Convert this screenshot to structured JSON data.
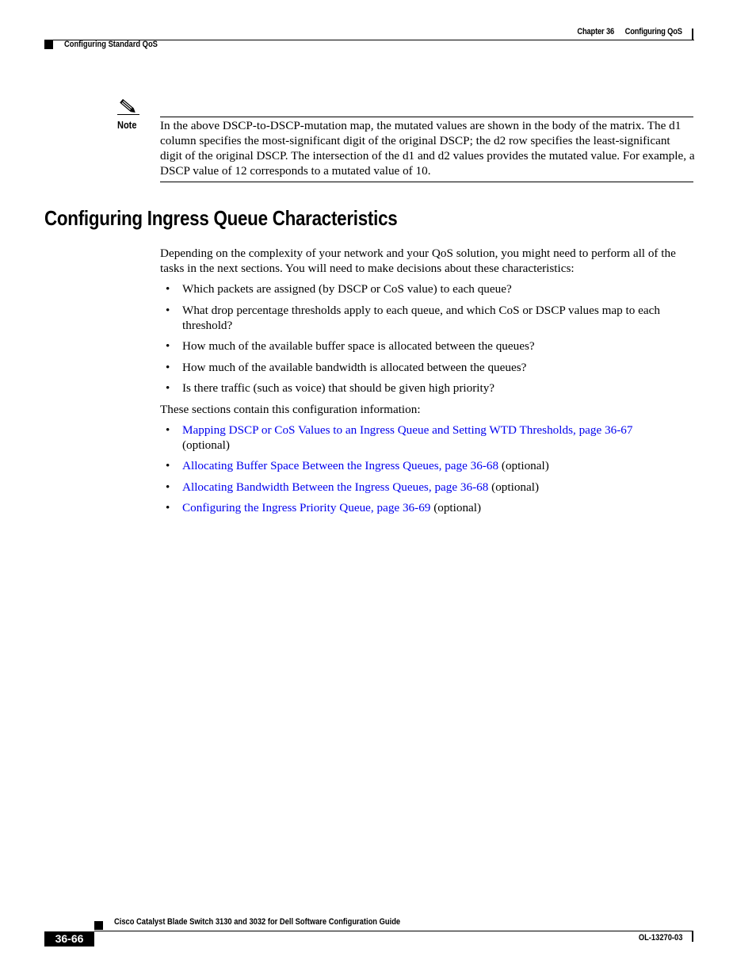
{
  "header": {
    "chapter": "Chapter 36",
    "chapter_title": "Configuring QoS",
    "section": "Configuring Standard QoS"
  },
  "note": {
    "icon": "pencil-note-icon",
    "label": "Note",
    "text": "In the above DSCP-to-DSCP-mutation map, the mutated values are shown in the body of the matrix. The d1 column specifies the most-significant digit of the original DSCP; the d2 row specifies the least-significant digit of the original DSCP. The intersection of the d1 and d2 values provides the mutated value. For example, a DSCP value of 12 corresponds to a mutated value of 10."
  },
  "section": {
    "heading": "Configuring Ingress Queue Characteristics",
    "intro": "Depending on the complexity of your network and your QoS solution, you might need to perform all of the tasks in the next sections. You will need to make decisions about these characteristics:",
    "questions": [
      "Which packets are assigned (by DSCP or CoS value) to each queue?",
      "What drop percentage thresholds apply to each queue, and which CoS or DSCP values map to each threshold?",
      "How much of the available buffer space is allocated between the queues?",
      "How much of the available bandwidth is allocated between the queues?",
      "Is there traffic (such as voice) that should be given high priority?"
    ],
    "sections_intro": "These sections contain this configuration information:",
    "links": [
      {
        "link": "Mapping DSCP or CoS Values to an Ingress Queue and Setting WTD Thresholds, page 36-67",
        "suffix": "(optional)"
      },
      {
        "link": "Allocating Buffer Space Between the Ingress Queues, page 36-68",
        "suffix": "(optional)"
      },
      {
        "link": "Allocating Bandwidth Between the Ingress Queues, page 36-68",
        "suffix": "(optional)"
      },
      {
        "link": "Configuring the Ingress Priority Queue, page 36-69",
        "suffix": "(optional)"
      }
    ],
    "bullet": "•"
  },
  "footer": {
    "guide_title": "Cisco Catalyst Blade Switch 3130 and 3032 for Dell Software Configuration Guide",
    "page_number": "36-66",
    "doc_number": "OL-13270-03"
  },
  "colors": {
    "link": "#0000ee",
    "text": "#000000"
  }
}
